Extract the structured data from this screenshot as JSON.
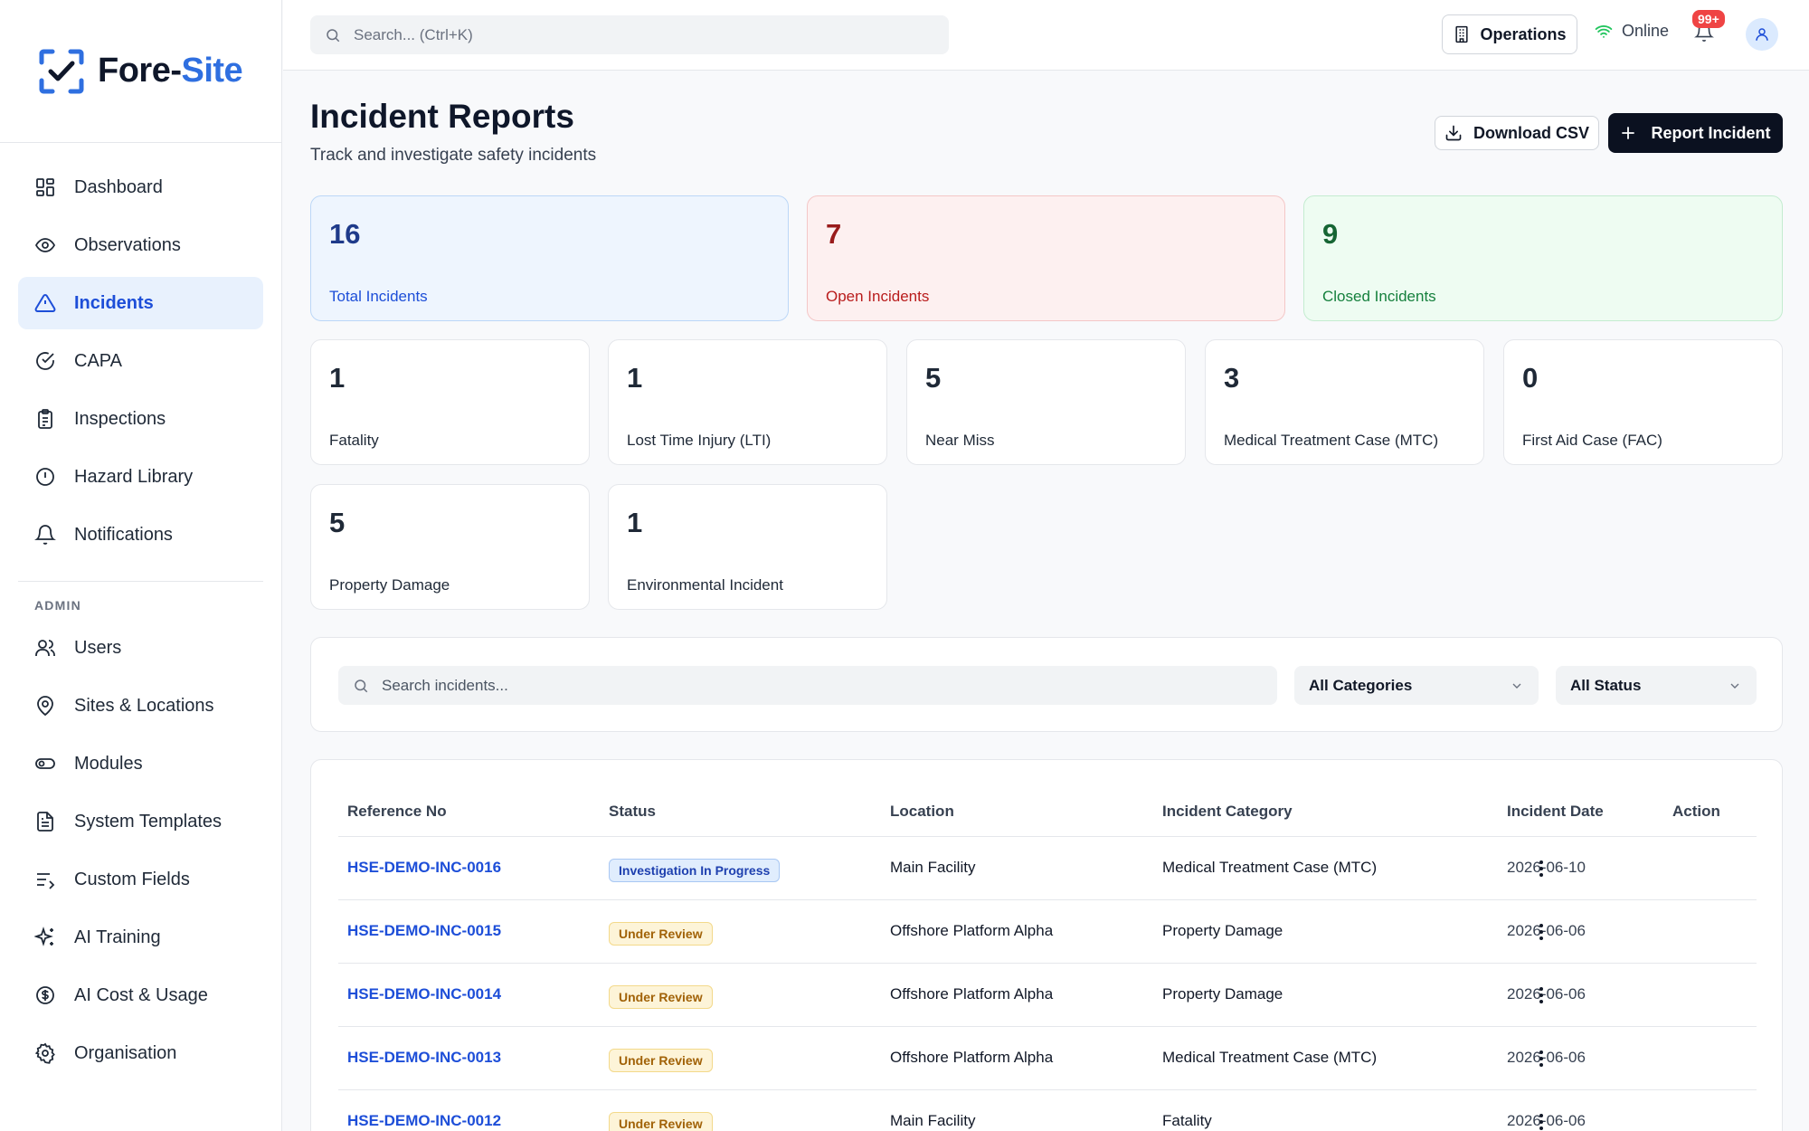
{
  "brand": {
    "name_main": "Fore-",
    "name_accent": "Site"
  },
  "sidebar": {
    "items": [
      {
        "label": "Dashboard",
        "icon": "grid-icon"
      },
      {
        "label": "Observations",
        "icon": "eye-icon"
      },
      {
        "label": "Incidents",
        "icon": "warning-triangle-icon",
        "active": true
      },
      {
        "label": "CAPA",
        "icon": "check-circle-icon"
      },
      {
        "label": "Inspections",
        "icon": "clipboard-icon"
      },
      {
        "label": "Hazard Library",
        "icon": "alert-circle-icon"
      },
      {
        "label": "Notifications",
        "icon": "bell-icon"
      }
    ],
    "admin_section": "ADMIN",
    "admin_items": [
      {
        "label": "Users",
        "icon": "users-icon"
      },
      {
        "label": "Sites & Locations",
        "icon": "map-pin-icon"
      },
      {
        "label": "Modules",
        "icon": "toggle-icon"
      },
      {
        "label": "System Templates",
        "icon": "file-text-icon"
      },
      {
        "label": "Custom Fields",
        "icon": "list-edit-icon"
      },
      {
        "label": "AI Training",
        "icon": "sparkles-icon"
      },
      {
        "label": "AI Cost & Usage",
        "icon": "dollar-circle-icon"
      },
      {
        "label": "Organisation",
        "icon": "gear-icon"
      }
    ]
  },
  "topbar": {
    "search_placeholder": "Search... (Ctrl+K)",
    "operations_label": "Operations",
    "online_label": "Online",
    "notification_count": "99+"
  },
  "header": {
    "title": "Incident Reports",
    "subtitle": "Track and investigate safety incidents",
    "download_label": "Download CSV",
    "report_label": "Report Incident"
  },
  "summary": [
    {
      "value": "16",
      "label": "Total Incidents"
    },
    {
      "value": "7",
      "label": "Open Incidents"
    },
    {
      "value": "9",
      "label": "Closed Incidents"
    }
  ],
  "categories": [
    {
      "value": "1",
      "label": "Fatality"
    },
    {
      "value": "1",
      "label": "Lost Time Injury (LTI)"
    },
    {
      "value": "5",
      "label": "Near Miss"
    },
    {
      "value": "3",
      "label": "Medical Treatment Case (MTC)"
    },
    {
      "value": "0",
      "label": "First Aid Case (FAC)"
    },
    {
      "value": "5",
      "label": "Property Damage"
    },
    {
      "value": "1",
      "label": "Environmental Incident"
    }
  ],
  "filters": {
    "search_placeholder": "Search incidents...",
    "category_value": "All Categories",
    "status_value": "All Status"
  },
  "table": {
    "columns": [
      "Reference No",
      "Status",
      "Location",
      "Incident Category",
      "Incident Date",
      "Action"
    ],
    "rows": [
      {
        "ref": "HSE-DEMO-INC-0016",
        "status": "Investigation In Progress",
        "location": "Main Facility",
        "category": "Medical Treatment Case (MTC)",
        "date": "2026-06-10"
      },
      {
        "ref": "HSE-DEMO-INC-0015",
        "status": "Under Review",
        "location": "Offshore Platform Alpha",
        "category": "Property Damage",
        "date": "2026-06-06"
      },
      {
        "ref": "HSE-DEMO-INC-0014",
        "status": "Under Review",
        "location": "Offshore Platform Alpha",
        "category": "Property Damage",
        "date": "2026-06-06"
      },
      {
        "ref": "HSE-DEMO-INC-0013",
        "status": "Under Review",
        "location": "Offshore Platform Alpha",
        "category": "Medical Treatment Case (MTC)",
        "date": "2026-06-06"
      },
      {
        "ref": "HSE-DEMO-INC-0012",
        "status": "Under Review",
        "location": "Main Facility",
        "category": "Fatality",
        "date": "2026-06-06"
      }
    ]
  },
  "colors": {
    "accent": "#2f6fe0",
    "primary_button": "#0b1120",
    "active_nav_bg": "#e8f1fd"
  }
}
